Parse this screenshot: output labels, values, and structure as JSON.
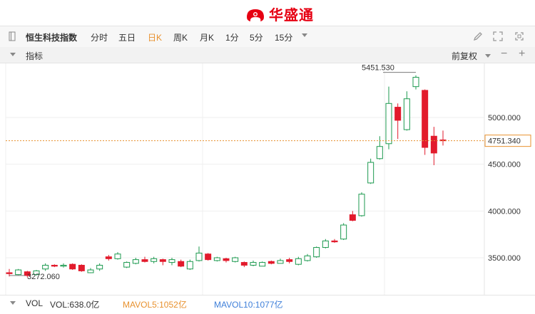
{
  "header": {
    "brand": "华盛通"
  },
  "toolbar": {
    "index_name": "恒生科技指数",
    "periods": [
      "分时",
      "五日",
      "日K",
      "周K",
      "月K",
      "1分",
      "5分",
      "15分"
    ],
    "active_period": "日K",
    "icons": [
      "pencil-icon",
      "expand-icon",
      "maximize-icon"
    ]
  },
  "indicator": {
    "label": "指标",
    "adjust": "前复权",
    "zoom_out": "−",
    "zoom_in": "+"
  },
  "colors": {
    "up": "#1c9a4f",
    "down": "#e21b2c",
    "accent": "#e8912e",
    "mavol5": "#e8912e",
    "mavol10": "#3e7fd9"
  },
  "chart_data": {
    "type": "candlestick",
    "y_ticks": [
      "5000.000",
      "4500.000",
      "4000.000",
      "3500.000"
    ],
    "y_tick_values": [
      5000,
      4500,
      4000,
      3500
    ],
    "current_price": "4751.340",
    "current_value": 4751.34,
    "high_label": "5451.530",
    "high_value": 5451.53,
    "low_label": "3272.060",
    "low_value": 3272.06,
    "candles": [
      [
        3340,
        3330,
        3380,
        3300
      ],
      [
        3320,
        3370,
        3380,
        3315
      ],
      [
        3350,
        3310,
        3360,
        3290
      ],
      [
        3320,
        3360,
        3370,
        3310
      ],
      [
        3380,
        3420,
        3440,
        3360
      ],
      [
        3420,
        3410,
        3430,
        3400
      ],
      [
        3410,
        3420,
        3440,
        3395
      ],
      [
        3430,
        3380,
        3440,
        3370
      ],
      [
        3420,
        3360,
        3430,
        3350
      ],
      [
        3340,
        3370,
        3390,
        3335
      ],
      [
        3380,
        3420,
        3440,
        3360
      ],
      [
        3510,
        3490,
        3530,
        3470
      ],
      [
        3490,
        3540,
        3560,
        3480
      ],
      [
        3400,
        3450,
        3460,
        3390
      ],
      [
        3440,
        3480,
        3500,
        3430
      ],
      [
        3480,
        3460,
        3510,
        3450
      ],
      [
        3460,
        3490,
        3510,
        3440
      ],
      [
        3480,
        3460,
        3490,
        3420
      ],
      [
        3450,
        3480,
        3500,
        3420
      ],
      [
        3460,
        3410,
        3480,
        3400
      ],
      [
        3380,
        3460,
        3480,
        3370
      ],
      [
        3470,
        3550,
        3620,
        3460
      ],
      [
        3540,
        3480,
        3550,
        3470
      ],
      [
        3470,
        3500,
        3510,
        3460
      ],
      [
        3490,
        3470,
        3500,
        3450
      ],
      [
        3460,
        3500,
        3510,
        3450
      ],
      [
        3450,
        3420,
        3460,
        3400
      ],
      [
        3420,
        3450,
        3470,
        3410
      ],
      [
        3410,
        3450,
        3460,
        3410
      ],
      [
        3460,
        3440,
        3470,
        3430
      ],
      [
        3440,
        3470,
        3490,
        3440
      ],
      [
        3480,
        3460,
        3500,
        3440
      ],
      [
        3430,
        3490,
        3510,
        3420
      ],
      [
        3470,
        3520,
        3540,
        3460
      ],
      [
        3510,
        3610,
        3620,
        3500
      ],
      [
        3610,
        3680,
        3700,
        3600
      ],
      [
        3680,
        3670,
        3700,
        3660
      ],
      [
        3700,
        3850,
        3870,
        3690
      ],
      [
        3960,
        3900,
        4000,
        3890
      ],
      [
        3950,
        4180,
        4200,
        3940
      ],
      [
        4300,
        4520,
        4560,
        4290
      ],
      [
        4560,
        4690,
        4800,
        4550
      ],
      [
        4720,
        5150,
        5330,
        4660
      ],
      [
        5110,
        4970,
        5150,
        4770
      ],
      [
        4870,
        5200,
        5280,
        4860
      ],
      [
        5330,
        5430,
        5450,
        5300
      ],
      [
        5290,
        4680,
        5300,
        4600
      ],
      [
        4800,
        4620,
        4900,
        4490
      ],
      [
        4760,
        4751.34,
        4860,
        4700
      ]
    ]
  },
  "volume": {
    "label": "VOL",
    "vol": "VOL:638.0亿",
    "mavol5": "MAVOL5:1052亿",
    "mavol10": "MAVOL10:1077亿"
  }
}
